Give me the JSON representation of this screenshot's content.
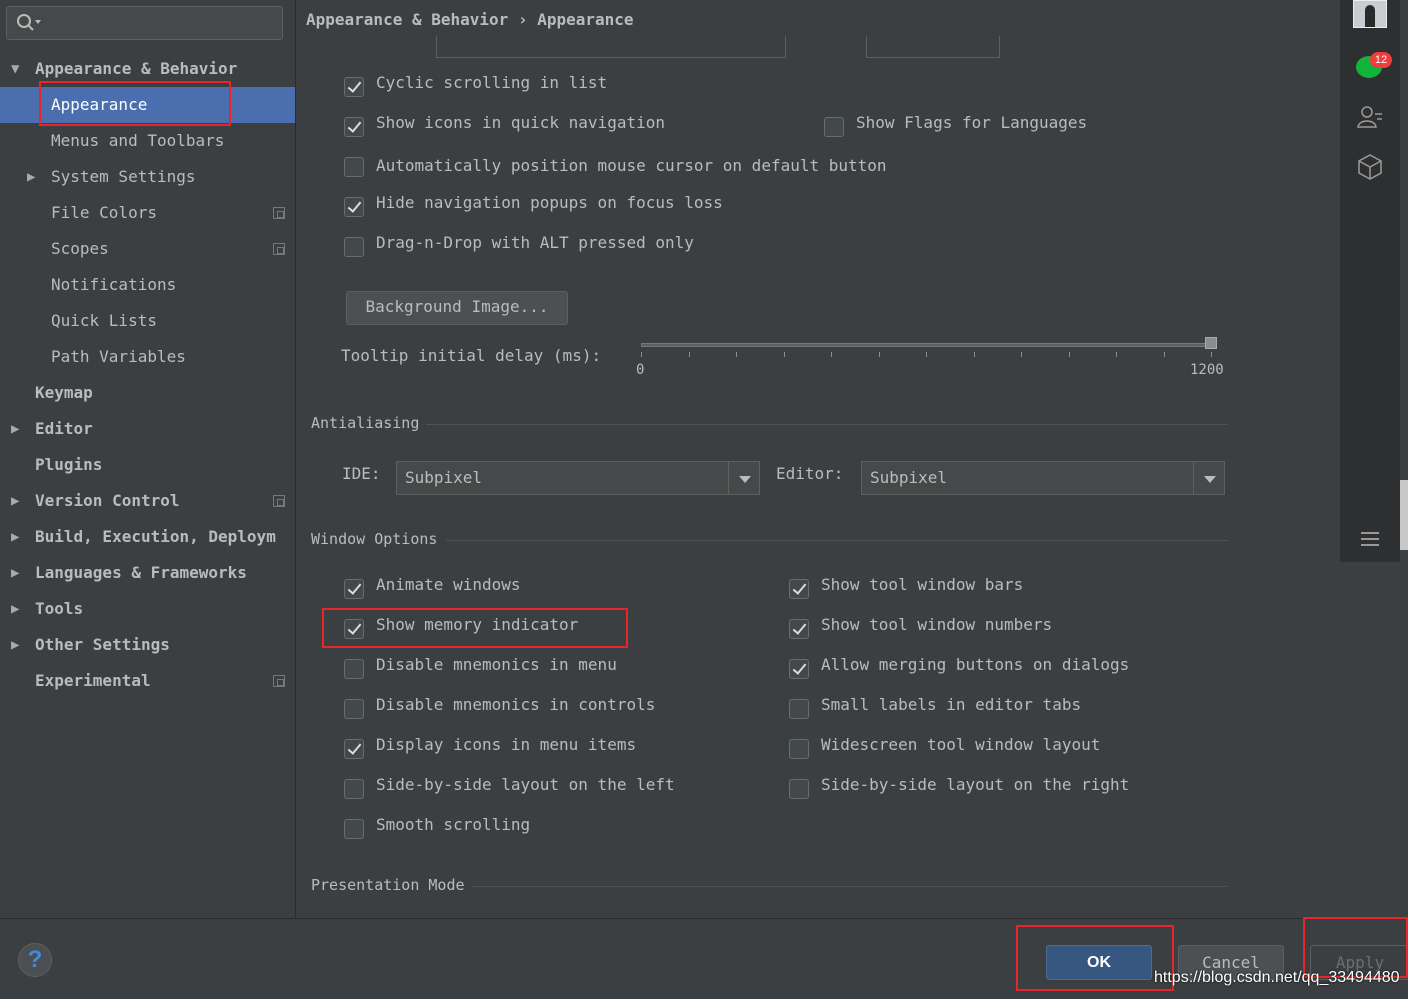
{
  "breadcrumb": {
    "parent": "Appearance & Behavior",
    "separator": "›",
    "current": "Appearance"
  },
  "sidebar": {
    "items": [
      {
        "label": "Appearance & Behavior",
        "level": 0,
        "arrow": "▼",
        "bold": true
      },
      {
        "label": "Appearance",
        "level": 1,
        "selected": true
      },
      {
        "label": "Menus and Toolbars",
        "level": 1
      },
      {
        "label": "System Settings",
        "level": 1,
        "arrow": "▶"
      },
      {
        "label": "File Colors",
        "level": 1,
        "project_icon": true
      },
      {
        "label": "Scopes",
        "level": 1,
        "project_icon": true
      },
      {
        "label": "Notifications",
        "level": 1
      },
      {
        "label": "Quick Lists",
        "level": 1
      },
      {
        "label": "Path Variables",
        "level": 1
      },
      {
        "label": "Keymap",
        "level": 0,
        "bold": true
      },
      {
        "label": "Editor",
        "level": 0,
        "arrow": "▶",
        "bold": true
      },
      {
        "label": "Plugins",
        "level": 0,
        "bold": true
      },
      {
        "label": "Version Control",
        "level": 0,
        "arrow": "▶",
        "bold": true,
        "project_icon": true
      },
      {
        "label": "Build, Execution, Deploym",
        "level": 0,
        "arrow": "▶",
        "bold": true
      },
      {
        "label": "Languages & Frameworks",
        "level": 0,
        "arrow": "▶",
        "bold": true
      },
      {
        "label": "Tools",
        "level": 0,
        "arrow": "▶",
        "bold": true
      },
      {
        "label": "Other Settings",
        "level": 0,
        "arrow": "▶",
        "bold": true
      },
      {
        "label": "Experimental",
        "level": 0,
        "bold": true,
        "project_icon": true
      }
    ]
  },
  "ui_options": {
    "cyclic_scrolling": {
      "label": "Cyclic scrolling in list",
      "checked": true
    },
    "show_icons_quick_nav": {
      "label": "Show icons in quick navigation",
      "checked": true
    },
    "show_flags": {
      "label": "Show Flags for Languages",
      "checked": false
    },
    "auto_position_mouse": {
      "label": "Automatically position mouse cursor on default button",
      "checked": false
    },
    "hide_nav_popups": {
      "label": "Hide navigation popups on focus loss",
      "checked": true
    },
    "drag_n_drop_alt": {
      "label": "Drag-n-Drop with ALT pressed only",
      "checked": false
    },
    "background_image_button": "Background Image...",
    "tooltip_delay": {
      "label": "Tooltip initial delay (ms):",
      "min": "0",
      "max": "1200",
      "value": 1200
    }
  },
  "antialiasing": {
    "title": "Antialiasing",
    "ide_label": "IDE:",
    "ide_value": "Subpixel",
    "editor_label": "Editor:",
    "editor_value": "Subpixel"
  },
  "window_options": {
    "title": "Window Options",
    "left": [
      {
        "label": "Animate windows",
        "checked": true
      },
      {
        "label": "Show memory indicator",
        "checked": true
      },
      {
        "label": "Disable mnemonics in menu",
        "checked": false
      },
      {
        "label": "Disable mnemonics in controls",
        "checked": false
      },
      {
        "label": "Display icons in menu items",
        "checked": true
      },
      {
        "label": "Side-by-side layout on the left",
        "checked": false
      },
      {
        "label": "Smooth scrolling",
        "checked": false
      }
    ],
    "right": [
      {
        "label": "Show tool window bars",
        "checked": true
      },
      {
        "label": "Show tool window numbers",
        "checked": true
      },
      {
        "label": "Allow merging buttons on dialogs",
        "checked": true
      },
      {
        "label": "Small labels in editor tabs",
        "checked": false
      },
      {
        "label": "Widescreen tool window layout",
        "checked": false
      },
      {
        "label": "Side-by-side layout on the right",
        "checked": false
      }
    ]
  },
  "presentation_mode": {
    "title": "Presentation Mode"
  },
  "footer": {
    "help_icon": "?",
    "ok": "OK",
    "cancel": "Cancel",
    "apply": "Apply"
  },
  "watermark": "https://blog.csdn.net/qq_33494480",
  "right_strip": {
    "badge": "12"
  },
  "colors": {
    "background": "#3c3f41",
    "selection": "#4b6eaf",
    "highlight": "#e8262a",
    "ok_button": "#365880"
  }
}
